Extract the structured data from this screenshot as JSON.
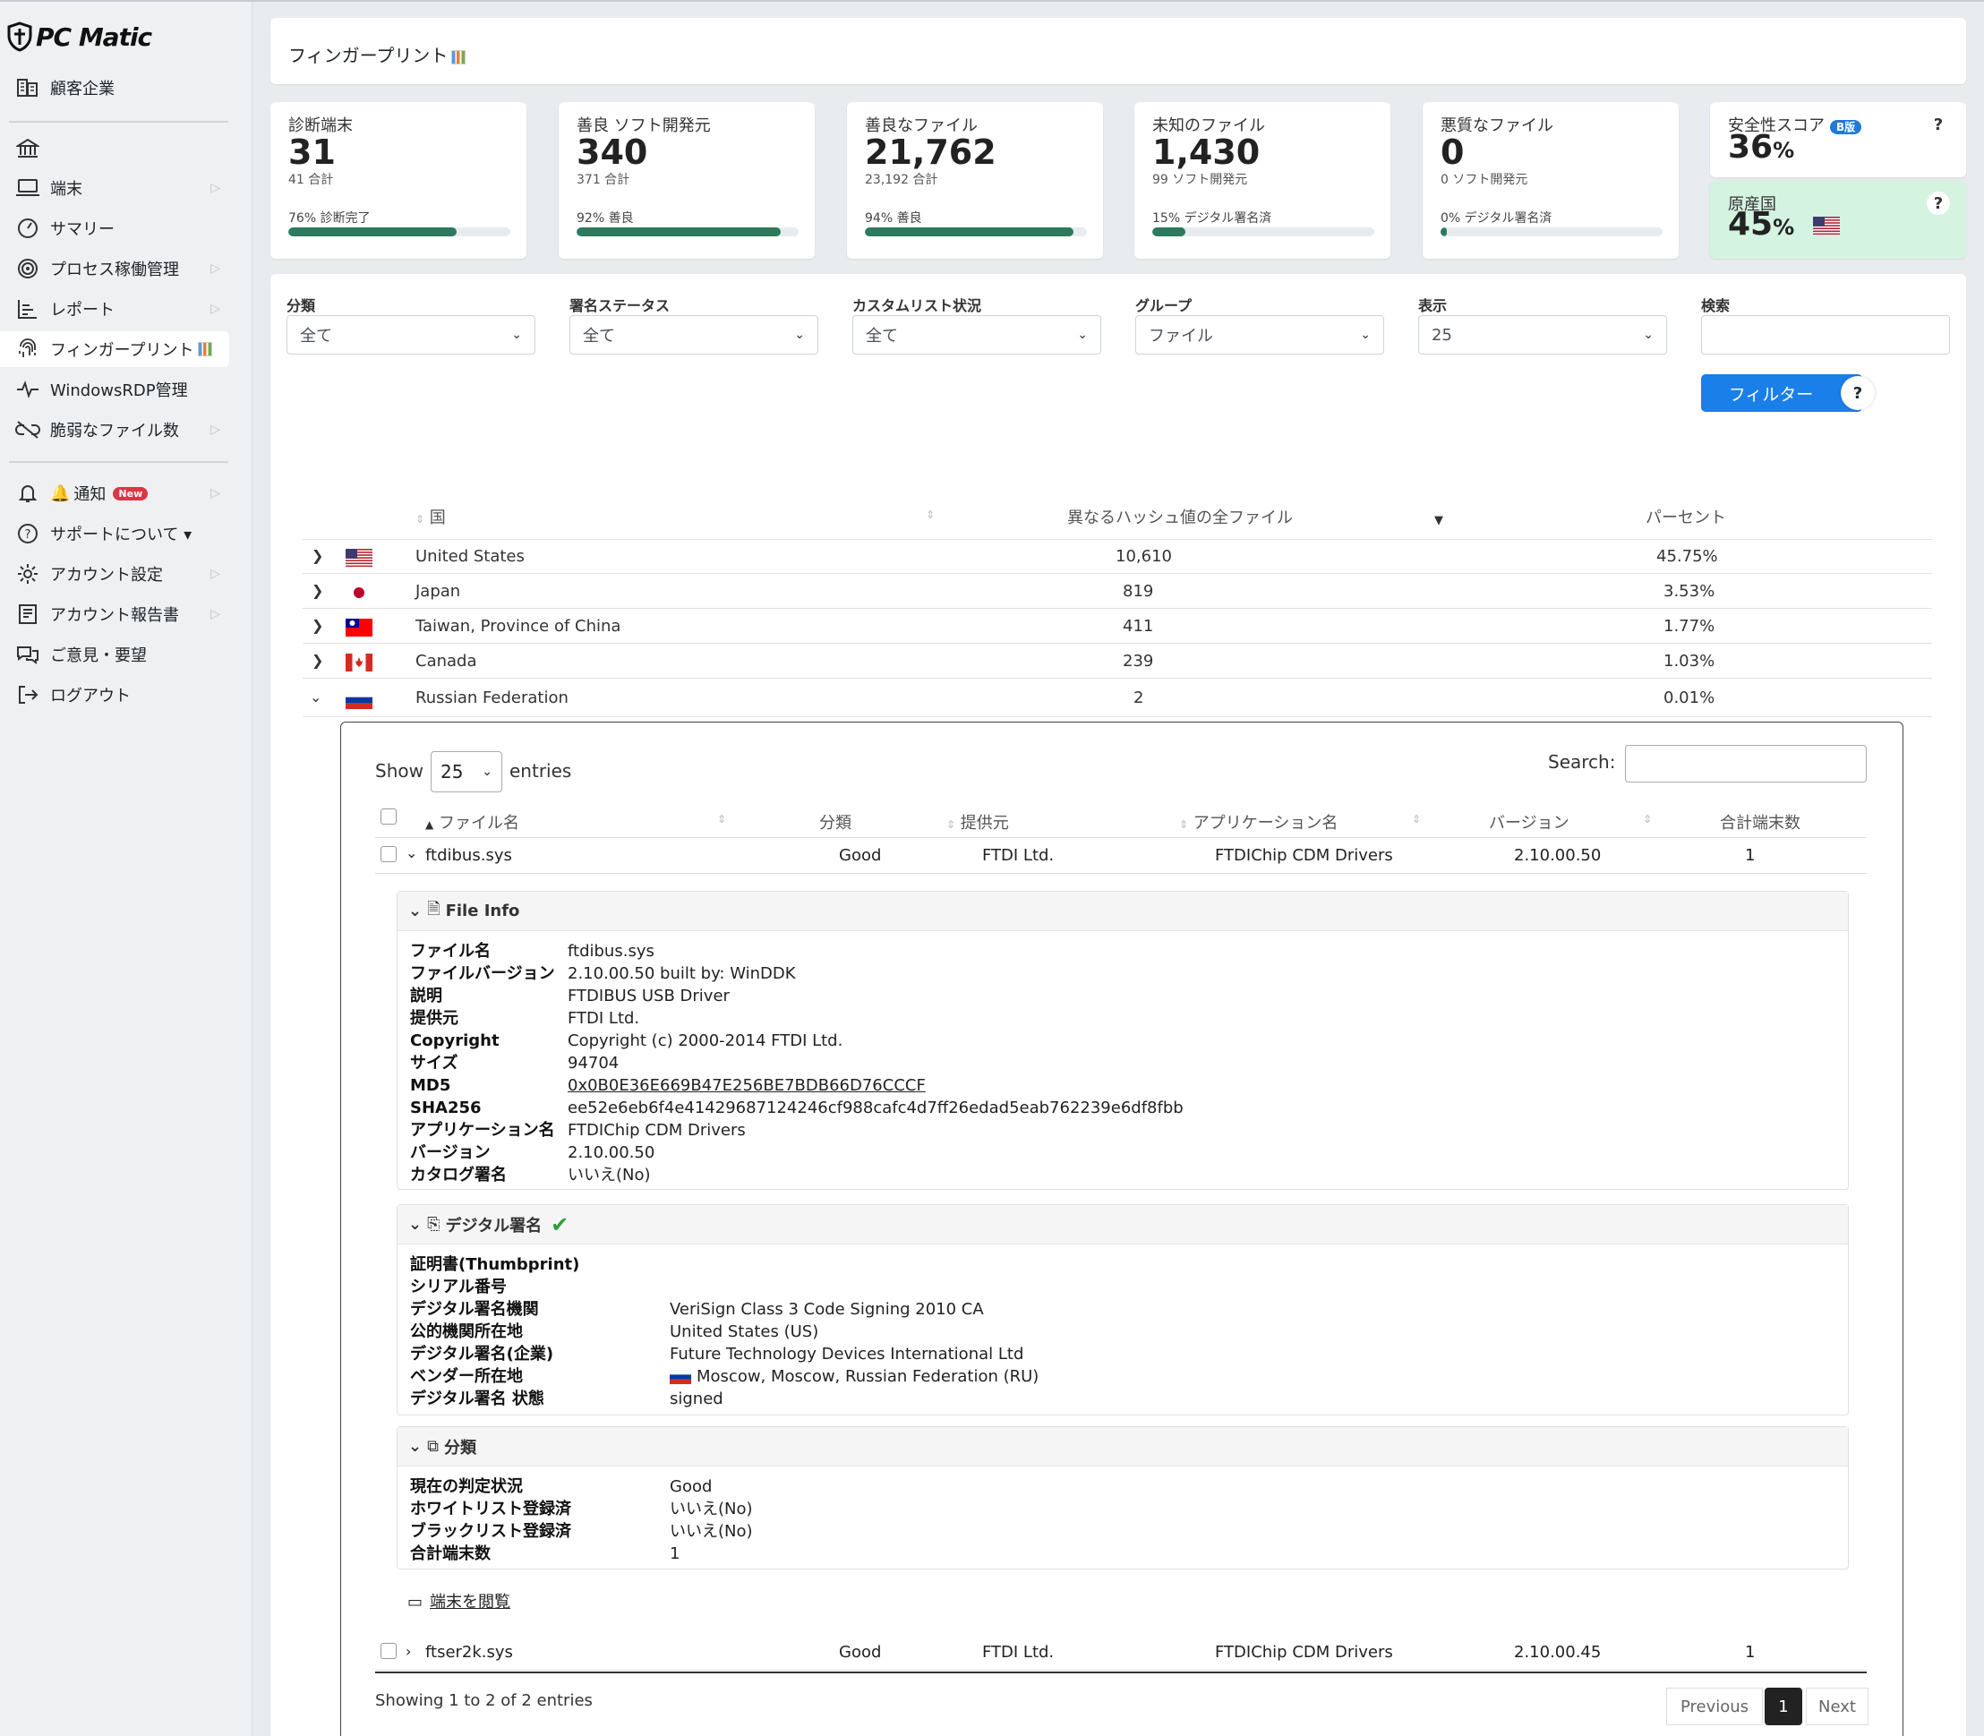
{
  "brand": {
    "name": "PC Matic"
  },
  "sidebar": {
    "items": [
      {
        "label": "顧客企業"
      },
      {
        "label": ""
      },
      {
        "label": "端末"
      },
      {
        "label": "サマリー"
      },
      {
        "label": "プロセス稼働管理"
      },
      {
        "label": "レポート"
      },
      {
        "label": "フィンガープリント"
      },
      {
        "label": "WindowsRDP管理"
      },
      {
        "label": "脆弱なファイル数"
      },
      {
        "label": "通知",
        "badge": "New"
      },
      {
        "label": "サポートについて ▾"
      },
      {
        "label": "アカウント設定"
      },
      {
        "label": "アカウント報告書"
      },
      {
        "label": "ご意見・要望"
      },
      {
        "label": "ログアウト"
      }
    ]
  },
  "header": {
    "title": "フィンガープリント"
  },
  "stats": [
    {
      "label": "診断端末",
      "value": "31",
      "sub": "41 合計",
      "progress_label": "76% 診断完了",
      "progress": 0.76
    },
    {
      "label": "善良 ソフト開発元",
      "value": "340",
      "sub": "371 合計",
      "progress_label": "92% 善良",
      "progress": 0.92
    },
    {
      "label": "善良なファイル",
      "value": "21,762",
      "sub": "23,192 合計",
      "progress_label": "94% 善良",
      "progress": 0.94
    },
    {
      "label": "未知のファイル",
      "value": "1,430",
      "sub": "99 ソフト開発元",
      "progress_label": "15% デジタル署名済",
      "progress": 0.15
    },
    {
      "label": "悪質なファイル",
      "value": "0",
      "sub": "0 ソフト開発元",
      "progress_label": "0% デジタル署名済",
      "progress": 0.03
    }
  ],
  "score": {
    "label": "安全性スコア",
    "badge": "B版",
    "value": "36",
    "unit": "%",
    "help": "?"
  },
  "origin": {
    "label": "原産国",
    "value": "45",
    "unit": "%",
    "help": "?"
  },
  "filters": {
    "category": {
      "label": "分類",
      "value": "全て"
    },
    "signature": {
      "label": "署名ステータス",
      "value": "全て"
    },
    "custom_list": {
      "label": "カスタムリスト状況",
      "value": "全て"
    },
    "group": {
      "label": "グループ",
      "value": "ファイル"
    },
    "display": {
      "label": "表示",
      "value": "25"
    },
    "search": {
      "label": "検索",
      "value": ""
    },
    "button": "フィルター",
    "help": "?"
  },
  "countries": {
    "headers": {
      "country": "国",
      "files": "異なるハッシュ値の全ファイル",
      "percent": "パーセント"
    },
    "rows": [
      {
        "name": "United States",
        "files": "10,610",
        "percent": "45.75%"
      },
      {
        "name": "Japan",
        "files": "819",
        "percent": "3.53%"
      },
      {
        "name": "Taiwan, Province of China",
        "files": "411",
        "percent": "1.77%"
      },
      {
        "name": "Canada",
        "files": "239",
        "percent": "1.03%"
      },
      {
        "name": "Russian Federation",
        "files": "2",
        "percent": "0.01%"
      }
    ]
  },
  "files_table": {
    "show_label": "Show",
    "entries_value": "25",
    "entries_label": "entries",
    "search_label": "Search:",
    "headers": {
      "filename": "ファイル名",
      "category": "分類",
      "vendor": "提供元",
      "app": "アプリケーション名",
      "version": "バージョン",
      "total": "合計端末数"
    },
    "rows": [
      {
        "filename": "ftdibus.sys",
        "category": "Good",
        "vendor": "FTDI Ltd.",
        "app": "FTDIChip CDM Drivers",
        "version": "2.10.00.50",
        "total": "1"
      },
      {
        "filename": "ftser2k.sys",
        "category": "Good",
        "vendor": "FTDI Ltd.",
        "app": "FTDIChip CDM Drivers",
        "version": "2.10.00.45",
        "total": "1"
      }
    ],
    "info": "Showing 1 to 2 of 2 entries",
    "pagination": {
      "prev": "Previous",
      "page": "1",
      "next": "Next"
    }
  },
  "file_info": {
    "title": "File Info",
    "fields": [
      {
        "k": "ファイル名",
        "v": "ftdibus.sys"
      },
      {
        "k": "ファイルバージョン",
        "v": "2.10.00.50 built by: WinDDK"
      },
      {
        "k": "説明",
        "v": "FTDIBUS USB Driver"
      },
      {
        "k": "提供元",
        "v": "FTDI Ltd."
      },
      {
        "k": "Copyright",
        "v": "Copyright (c) 2000-2014 FTDI Ltd."
      },
      {
        "k": "サイズ",
        "v": "94704"
      },
      {
        "k": "MD5",
        "v": "0x0B0E36E669B47E256BE7BDB66D76CCCF"
      },
      {
        "k": "SHA256",
        "v": "ee52e6eb6f4e41429687124246cf988cafc4d7ff26edad5eab762239e6df8fbb"
      },
      {
        "k": "アプリケーション名",
        "v": "FTDIChip CDM Drivers"
      },
      {
        "k": "バージョン",
        "v": "2.10.00.50"
      },
      {
        "k": "カタログ署名",
        "v": "いいえ(No)"
      }
    ]
  },
  "signature": {
    "title": "デジタル署名",
    "fields": [
      {
        "k": "証明書(Thumbprint)",
        "v": ""
      },
      {
        "k": "シリアル番号",
        "v": ""
      },
      {
        "k": "デジタル署名機関",
        "v": "VeriSign Class 3 Code Signing 2010 CA"
      },
      {
        "k": "公的機関所在地",
        "v": "United States (US)"
      },
      {
        "k": "デジタル署名(企業)",
        "v": "Future Technology Devices International Ltd"
      },
      {
        "k": "ベンダー所在地",
        "v": "Moscow, Moscow, Russian Federation (RU)"
      },
      {
        "k": "デジタル署名 状態",
        "v": "signed"
      }
    ]
  },
  "classification": {
    "title": "分類",
    "fields": [
      {
        "k": "現在の判定状況",
        "v": "Good"
      },
      {
        "k": "ホワイトリスト登録済",
        "v": "いいえ(No)"
      },
      {
        "k": "ブラックリスト登録済",
        "v": "いいえ(No)"
      },
      {
        "k": "合計端末数",
        "v": "1"
      }
    ]
  },
  "view_devices": "端末を閲覧"
}
